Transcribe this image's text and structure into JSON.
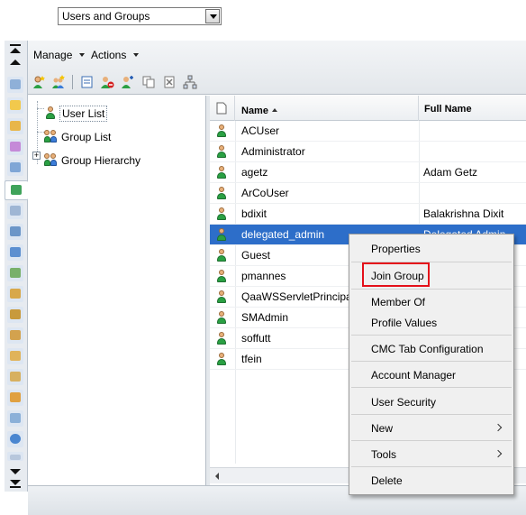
{
  "top_select": {
    "value": "Users and Groups"
  },
  "toolbar": {
    "manage_label": "Manage",
    "actions_label": "Actions"
  },
  "tree": {
    "items": [
      {
        "label": "User List",
        "selected": true,
        "icon": "user-list-icon"
      },
      {
        "label": "Group List",
        "selected": false,
        "icon": "group-list-icon"
      },
      {
        "label": "Group Hierarchy",
        "selected": false,
        "icon": "group-hierarchy-icon"
      }
    ]
  },
  "grid": {
    "columns": [
      "Name",
      "Full Name"
    ],
    "sort_column": "Name",
    "sort_direction": "ascending",
    "rows": [
      {
        "name": "ACUser",
        "full_name": ""
      },
      {
        "name": "Administrator",
        "full_name": ""
      },
      {
        "name": "agetz",
        "full_name": "Adam Getz"
      },
      {
        "name": "ArCoUser",
        "full_name": ""
      },
      {
        "name": "bdixit",
        "full_name": "Balakrishna Dixit"
      },
      {
        "name": "delegated_admin",
        "full_name": "Delegated Admin",
        "selected": true
      },
      {
        "name": "Guest",
        "full_name": ""
      },
      {
        "name": "pmannes",
        "full_name": ""
      },
      {
        "name": "QaaWSServletPrincipal",
        "full_name": ""
      },
      {
        "name": "SMAdmin",
        "full_name": ""
      },
      {
        "name": "soffutt",
        "full_name": ""
      },
      {
        "name": "tfein",
        "full_name": ""
      }
    ]
  },
  "context_menu": {
    "properties": "Properties",
    "join_group": "Join Group",
    "member_of": "Member Of",
    "profile_values": "Profile Values",
    "cmc_tab": "CMC Tab Configuration",
    "account_manager": "Account Manager",
    "user_security": "User Security",
    "new": "New",
    "tools": "Tools",
    "delete": "Delete"
  },
  "colors": {
    "selection": "#2d6ec9",
    "highlight_box": "#e4101a",
    "user_icon_green": "#2aa043"
  }
}
